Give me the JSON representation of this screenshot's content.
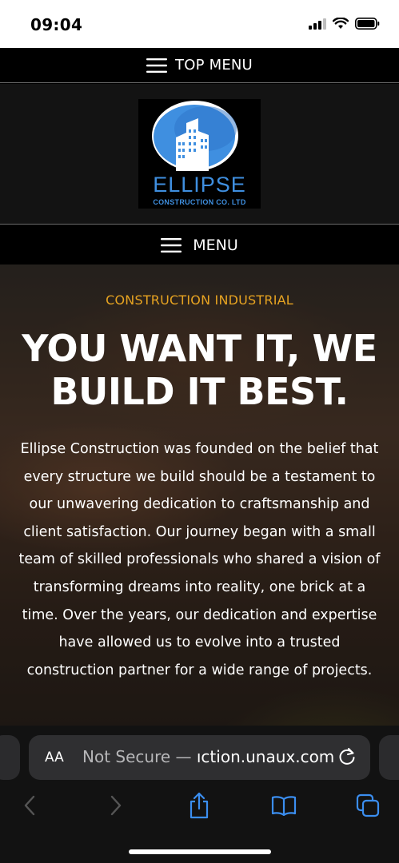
{
  "status_bar": {
    "time": "09:04"
  },
  "top_menu": {
    "label": "TOP MENU"
  },
  "logo": {
    "name": "ELLIPSE",
    "subtitle": "CONSTRUCTION CO. LTD"
  },
  "main_menu": {
    "label": "MENU"
  },
  "hero": {
    "eyebrow": "CONSTRUCTION INDUSTRIAL",
    "title_line1": "YOU WANT IT, WE",
    "title_line2": "BUILD IT BEST.",
    "body": "Ellipse Construction was founded on the belief that every structure we build should be a testament to our unwavering dedication to craftsmanship and client satisfaction. Our journey began with a small team of skilled professionals who shared a vision of transforming dreams into reality, one brick at a time. Over the years, our dedication and expertise have allowed us to evolve into a trusted construction partner for a wide range of projects."
  },
  "browser": {
    "text_size_label": "AA",
    "security_label": "Not Secure —",
    "url_host": "ıction.unaux.com"
  },
  "colors": {
    "accent": "#e6a321",
    "logo_blue": "#3f8fe0"
  }
}
